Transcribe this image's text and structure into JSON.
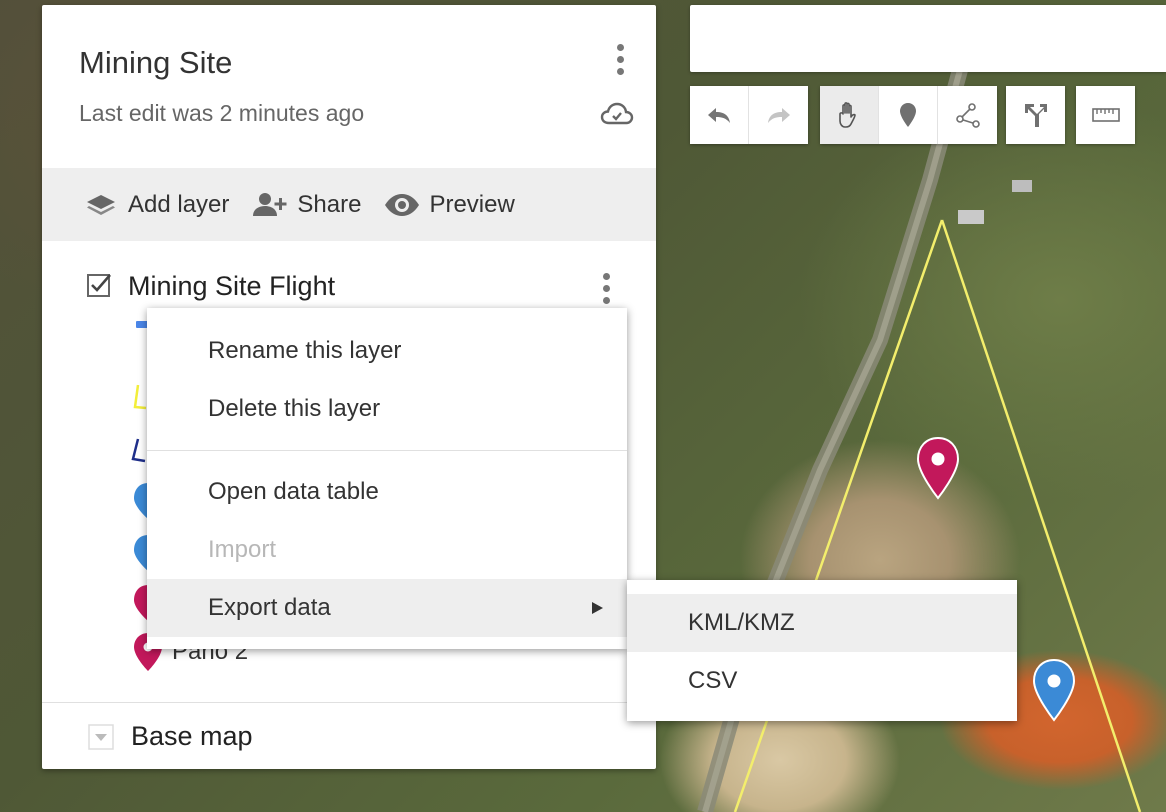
{
  "map": {
    "title": "Mining Site",
    "last_edit": "Last edit was 2 minutes ago"
  },
  "actions": {
    "add_layer": "Add layer",
    "share": "Share",
    "preview": "Preview"
  },
  "layer": {
    "name": "Mining Site Flight",
    "checked": true,
    "visible_feature_label": "Pano 2"
  },
  "base_map": {
    "label": "Base map"
  },
  "context_menu": {
    "items": [
      {
        "label": "Rename this layer",
        "enabled": true
      },
      {
        "label": "Delete this layer",
        "enabled": true
      },
      {
        "label": "Open data table",
        "enabled": true
      },
      {
        "label": "Import",
        "enabled": false
      },
      {
        "label": "Export data",
        "enabled": true,
        "has_submenu": true,
        "highlighted": true
      }
    ]
  },
  "export_submenu": {
    "items": [
      {
        "label": "KML/KMZ",
        "highlighted": true
      },
      {
        "label": "CSV",
        "highlighted": false
      }
    ]
  },
  "toolbar": {
    "tools": [
      "undo-icon",
      "redo-icon",
      "hand-icon",
      "marker-icon",
      "line-icon",
      "directions-icon",
      "ruler-icon"
    ],
    "active_tool": "hand-icon"
  },
  "colors": {
    "polygon_outline": "#f3ee6c",
    "marker_crimson": "#c2185b",
    "marker_blue": "#3b8ad6",
    "panel_bar": "#eeeeee"
  }
}
